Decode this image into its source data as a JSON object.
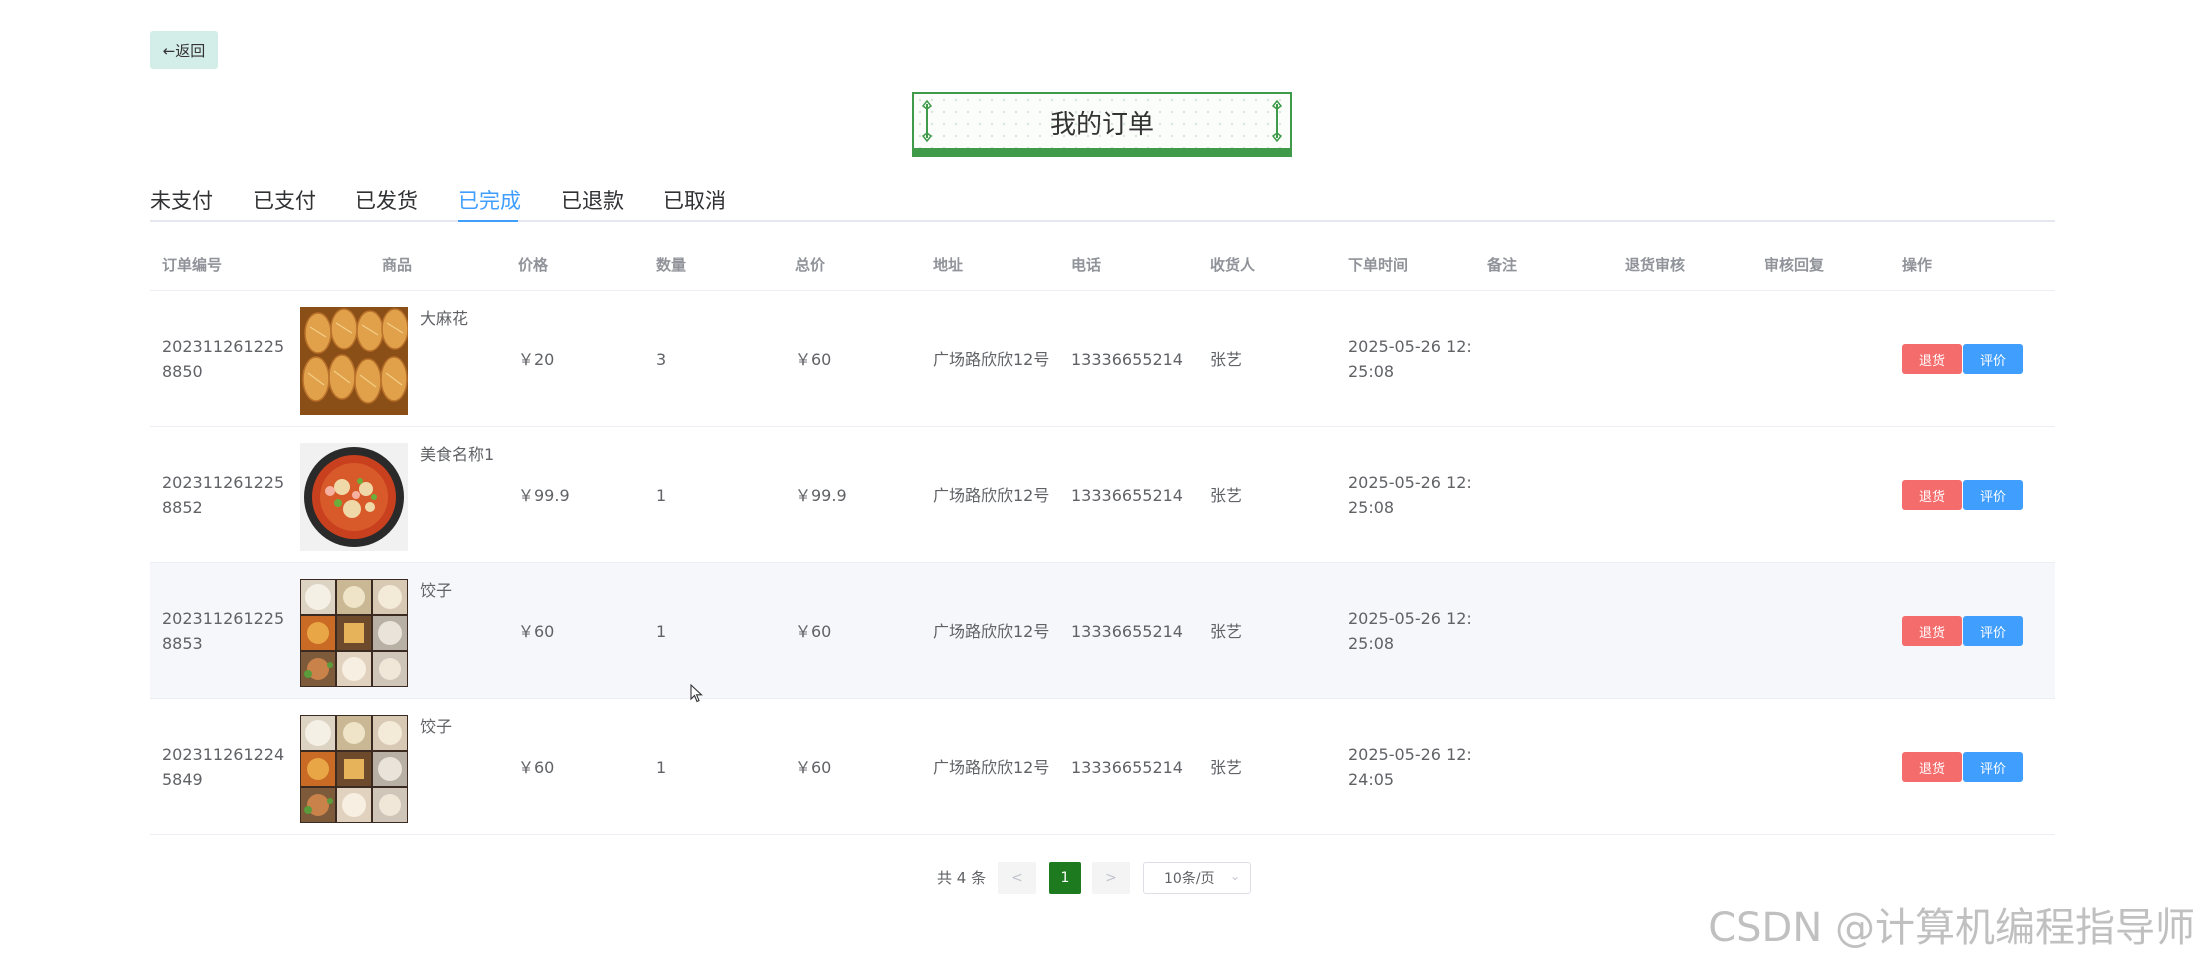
{
  "back_button": {
    "icon": "arrow-left-icon",
    "label": "←返回"
  },
  "page_title": "我的订单",
  "tabs": [
    {
      "label": "未支付"
    },
    {
      "label": "已支付"
    },
    {
      "label": "已发货"
    },
    {
      "label": "已完成",
      "active": true
    },
    {
      "label": "已退款"
    },
    {
      "label": "已取消"
    }
  ],
  "table": {
    "columns": [
      "订单编号",
      "商品",
      "价格",
      "数量",
      "总价",
      "地址",
      "电话",
      "收货人",
      "下单时间",
      "备注",
      "退货审核",
      "审核回复",
      "操作"
    ],
    "rows": [
      {
        "order_no": "2023112612258850",
        "goods_name": "大麻花",
        "price": "￥20",
        "qty": "3",
        "total": "￥60",
        "address": "广场路欣欣12号",
        "phone": "13336655214",
        "receiver": "张艺",
        "time": "2025-05-26 12:25:08",
        "remark": "",
        "refund_review": "",
        "review_reply": ""
      },
      {
        "order_no": "2023112612258852",
        "goods_name": "美食名称1",
        "price": "￥99.9",
        "qty": "1",
        "total": "￥99.9",
        "address": "广场路欣欣12号",
        "phone": "13336655214",
        "receiver": "张艺",
        "time": "2025-05-26 12:25:08",
        "remark": "",
        "refund_review": "",
        "review_reply": ""
      },
      {
        "order_no": "2023112612258853",
        "goods_name": "饺子",
        "price": "￥60",
        "qty": "1",
        "total": "￥60",
        "address": "广场路欣欣12号",
        "phone": "13336655214",
        "receiver": "张艺",
        "time": "2025-05-26 12:25:08",
        "remark": "",
        "refund_review": "",
        "review_reply": ""
      },
      {
        "order_no": "2023112612245849",
        "goods_name": "饺子",
        "price": "￥60",
        "qty": "1",
        "total": "￥60",
        "address": "广场路欣欣12号",
        "phone": "13336655214",
        "receiver": "张艺",
        "time": "2025-05-26 12:24:05",
        "remark": "",
        "refund_review": "",
        "review_reply": ""
      }
    ],
    "actions": {
      "refund_label": "退货",
      "review_label": "评价"
    }
  },
  "pagination": {
    "total_text": "共 4 条",
    "prev": "<",
    "current_page": "1",
    "next": ">",
    "page_size": "10条/页"
  },
  "watermark": "CSDN @计算机编程指导师",
  "colors": {
    "accent": "#409eff",
    "title_green": "#3f9a4a",
    "page_active": "#1e7a1e",
    "refund": "#f56c6c",
    "back_bg": "#d3ede9"
  }
}
